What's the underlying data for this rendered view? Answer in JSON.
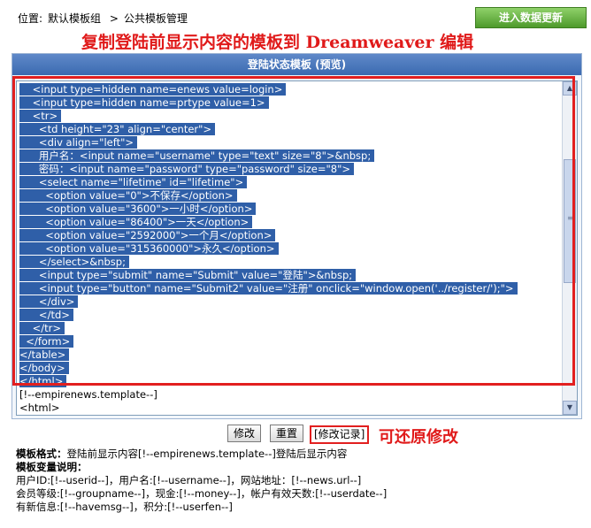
{
  "breadcrumb": {
    "label": "位置:",
    "group_link": "默认模板组",
    "separator": ">",
    "current": "公共模板管理"
  },
  "toolbar": {
    "update_button": "进入数据更新"
  },
  "annotations": {
    "top": "复制登陆前显示内容的模板到 Dreamweaver 编辑",
    "right": "可还原修改"
  },
  "panel": {
    "title": "登陆状态模板 (预览)"
  },
  "editor": {
    "selected_lines": [
      "    <input type=hidden name=enews value=login>",
      "    <input type=hidden name=prtype value=1>",
      "    <tr>",
      "      <td height=\"23\" align=\"center\">",
      "      <div align=\"left\">",
      "      用户名：<input name=\"username\" type=\"text\" size=\"8\">&nbsp;",
      "      密码：<input name=\"password\" type=\"password\" size=\"8\">",
      "      <select name=\"lifetime\" id=\"lifetime\">",
      "        <option value=\"0\">不保存</option>",
      "        <option value=\"3600\">一小时</option>",
      "        <option value=\"86400\">一天</option>",
      "        <option value=\"2592000\">一个月</option>",
      "        <option value=\"315360000\">永久</option>",
      "      </select>&nbsp;",
      "      <input type=\"submit\" name=\"Submit\" value=\"登陆\">&nbsp;",
      "      <input type=\"button\" name=\"Submit2\" value=\"注册\" onclick=\"window.open('../register/');\">",
      "      </div>",
      "      </td>",
      "    </tr>",
      "  </form>",
      "</table>",
      "</body>",
      "</html>"
    ],
    "unselected_lines": [
      "[!--empirenews.template--]",
      "<html>"
    ]
  },
  "buttons": {
    "modify": "修改",
    "reset": "重置",
    "history": "[修改记录]"
  },
  "info": {
    "format_label": "模板格式：",
    "format_text": "登陆前显示内容[!--empirenews.template--]登陆后显示内容",
    "vars_label": "模板变量说明：",
    "line1": "用户ID:[!--userid--]，用户名:[!--username--]，网站地址：[!--news.url--]",
    "line2": "会员等级:[!--groupname--]，现金:[!--money--]，帐户有效天数:[!--userdate--]",
    "line3": "有新信息:[!--havemsg--]，积分:[!--userfen--]"
  }
}
